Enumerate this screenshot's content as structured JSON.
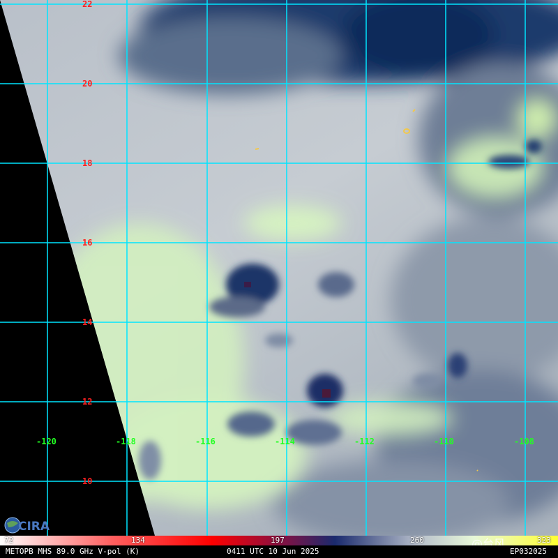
{
  "product": {
    "sensor_label": "METOPB MHS 89.0 GHz V-pol (K)",
    "time_label": "0411 UTC 10 Jun 2025",
    "storm_id": "EP032025"
  },
  "logo": {
    "text": "CIRA"
  },
  "watermark": {
    "text": "@台风"
  },
  "latitudes": [
    "22",
    "20",
    "18",
    "16",
    "14",
    "12",
    "10"
  ],
  "longitudes": [
    "-120",
    "-118",
    "-116",
    "-114",
    "-112",
    "-110",
    "-108"
  ],
  "colorbar": {
    "ticks": [
      "72",
      "134",
      "197",
      "260",
      "323"
    ],
    "colors": [
      "#ffffff",
      "#ff1010",
      "#1a1a6e",
      "#ffffff",
      "#ffff40"
    ]
  },
  "colors": {
    "grid": "#00e5ff",
    "lat_label": "#ff2020",
    "lon_label": "#22ff22",
    "no_data": "#000000",
    "warm_surface": "#d8f2c4",
    "cloud": "#c8cdd4",
    "deep_convection": "#1a2f66"
  }
}
